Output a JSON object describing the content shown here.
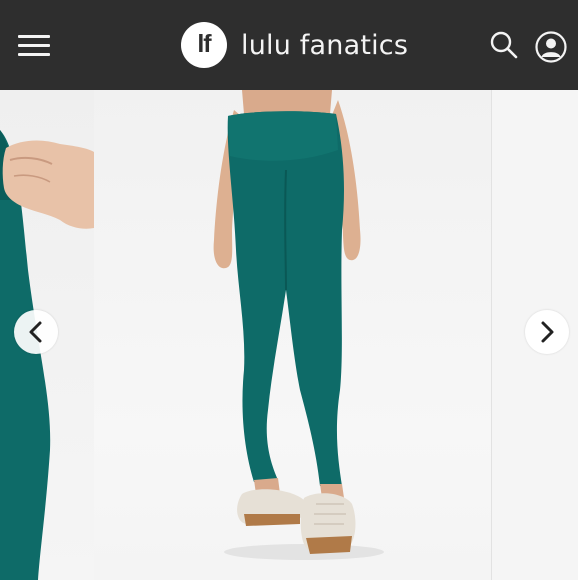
{
  "header": {
    "menu_icon": "hamburger-menu-icon",
    "logo_text": "lf",
    "brand_name": "lulu fanatics",
    "search_icon": "search-icon",
    "account_icon": "user-account-icon",
    "background": "#2e2e2e",
    "foreground": "#f4f4f4"
  },
  "carousel": {
    "prev_icon": "chevron-left-icon",
    "next_icon": "chevron-right-icon",
    "product_color": "#0e6b68"
  }
}
